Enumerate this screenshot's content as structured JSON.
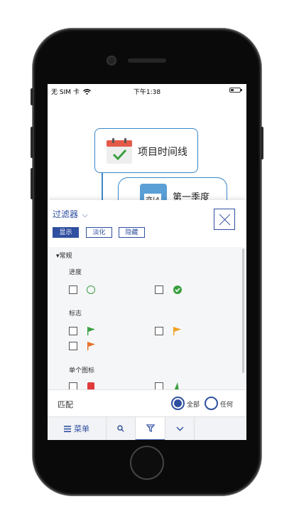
{
  "status_bar": {
    "carrier": "无 SIM 卡",
    "time": "下午1:38",
    "battery_level": 0.3
  },
  "mindmap": {
    "root_node": {
      "label": "项目时间线",
      "icon": "calendar-check-icon"
    },
    "child_node": {
      "label": "第一季度",
      "icon_text": "亦|4"
    }
  },
  "filter": {
    "title": "过滤器",
    "modes": [
      "显示",
      "淡化",
      "隐藏"
    ],
    "active_mode": "显示",
    "section": "常规",
    "groups": [
      {
        "label": "进度",
        "items": [
          {
            "icon": "progress-empty-icon",
            "checked": false
          },
          {
            "icon": "progress-done-icon",
            "checked": false
          }
        ]
      },
      {
        "label": "标志",
        "items": [
          {
            "icon": "green-flag-icon",
            "checked": false
          },
          {
            "icon": "yellow-flag-icon",
            "checked": false
          },
          {
            "icon": "orange-flag-icon",
            "checked": false
          }
        ]
      },
      {
        "label": "单个图标",
        "items": [
          {
            "icon": "red-icon",
            "checked": false
          },
          {
            "icon": "green-icon",
            "checked": false
          }
        ]
      }
    ],
    "match_label": "匹配",
    "match_options": [
      "全部",
      "任何"
    ],
    "match_selected": "全部"
  },
  "toolbar": {
    "menu_label": "菜单",
    "icons": [
      "menu-icon",
      "search-icon",
      "filter-icon",
      "chevron-down-icon"
    ]
  },
  "colors": {
    "accent": "#2f4fa0",
    "node_border": "#3a86c8",
    "green": "#3aa040",
    "yellow": "#f0a020",
    "orange": "#e8702a",
    "red": "#e03a3a"
  }
}
